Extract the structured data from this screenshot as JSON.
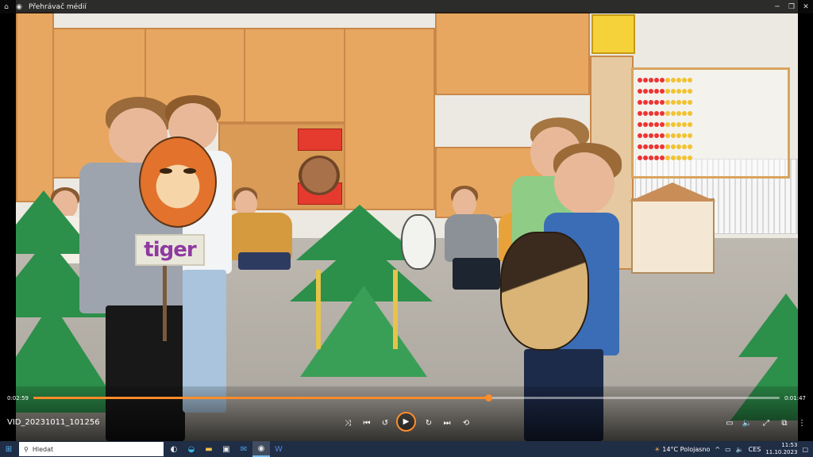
{
  "window": {
    "title": "Přehrávač médií",
    "home_icon": "home-icon",
    "app_icon": "media-player-icon",
    "controls": [
      "minimize-icon",
      "restore-icon",
      "close-icon"
    ]
  },
  "video": {
    "sign_text": "tiger"
  },
  "player": {
    "time_current": "0:02:59",
    "time_total": "0:01:47",
    "progress": 0.61,
    "filename": "VID_20231011_101256",
    "accent": "#ff8c2a",
    "buttons": [
      "shuffle-icon",
      "previous-icon",
      "rewind-10-icon",
      "play-icon",
      "forward-30-icon",
      "next-icon",
      "repeat-icon"
    ],
    "right_buttons": [
      "miniplayer-icon",
      "volume-icon",
      "fullscreen-icon",
      "cast-icon",
      "more-icon"
    ]
  },
  "taskbar": {
    "search_placeholder": "Hledat",
    "weather": "14°C Polojasno",
    "language": "CES",
    "time": "11:53",
    "date": "11.10.2023",
    "apps": [
      "task-view-icon",
      "edge-icon",
      "file-explorer-icon",
      "store-icon",
      "mail-icon",
      "media-player-icon",
      "word-icon"
    ]
  }
}
